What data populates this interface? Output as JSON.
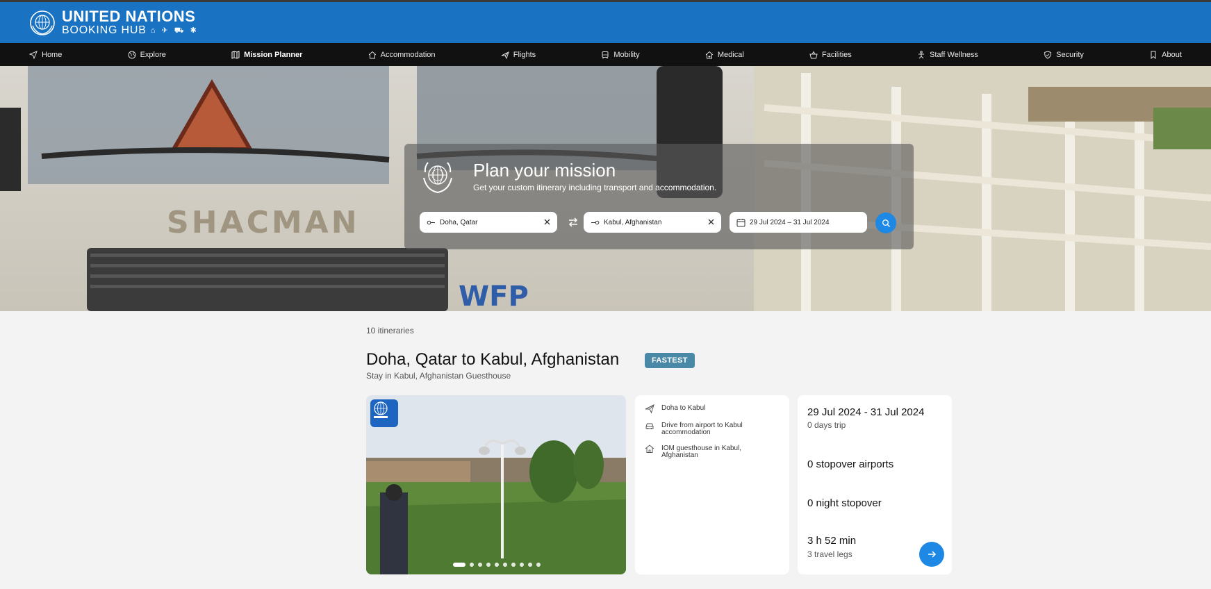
{
  "brand": {
    "title": "UNITED NATIONS",
    "subtitle": "BOOKING HUB",
    "service_glyphs": "⌂ ✈ ⛟ ✱",
    "primary_color": "#1a73c2"
  },
  "nav": {
    "items": [
      {
        "label": "Home",
        "icon": "navigate-icon"
      },
      {
        "label": "Explore",
        "icon": "globe-icon"
      },
      {
        "label": "Mission Planner",
        "icon": "map-icon",
        "active": true
      },
      {
        "label": "Accommodation",
        "icon": "house-icon"
      },
      {
        "label": "Flights",
        "icon": "plane-icon"
      },
      {
        "label": "Mobility",
        "icon": "bus-icon"
      },
      {
        "label": "Medical",
        "icon": "medical-house-icon"
      },
      {
        "label": "Facilities",
        "icon": "basket-icon"
      },
      {
        "label": "Staff Wellness",
        "icon": "wellness-icon"
      },
      {
        "label": "Security",
        "icon": "shield-icon"
      },
      {
        "label": "About",
        "icon": "bookmark-icon"
      }
    ]
  },
  "planner": {
    "title": "Plan your mission",
    "subtitle": "Get your custom itinerary including transport and accommodation.",
    "origin": "Doha, Qatar",
    "destination": "Kabul, Afghanistan",
    "dates": "29 Jul 2024 – 31 Jul 2024"
  },
  "results": {
    "count": "10 itineraries",
    "route_title": "Doha, Qatar to Kabul, Afghanistan",
    "badge": "FASTEST",
    "stay": "Stay in Kabul, Afghanistan Guesthouse",
    "image_index": 1,
    "image_total": 10,
    "legs": [
      {
        "icon": "plane-icon",
        "text": "Doha to Kabul"
      },
      {
        "icon": "car-icon",
        "text": "Drive from airport to Kabul accommodation"
      },
      {
        "icon": "house-icon",
        "text": "IOM guesthouse in Kabul, Afghanistan"
      }
    ],
    "summary": {
      "dates": "29 Jul 2024 - 31 Jul 2024",
      "days": "0 days trip",
      "stopover_airports": "0 stopover airports",
      "night_stopover": "0 night stopover",
      "duration": "3 h 52 min",
      "travel_legs": "3 travel legs"
    }
  }
}
